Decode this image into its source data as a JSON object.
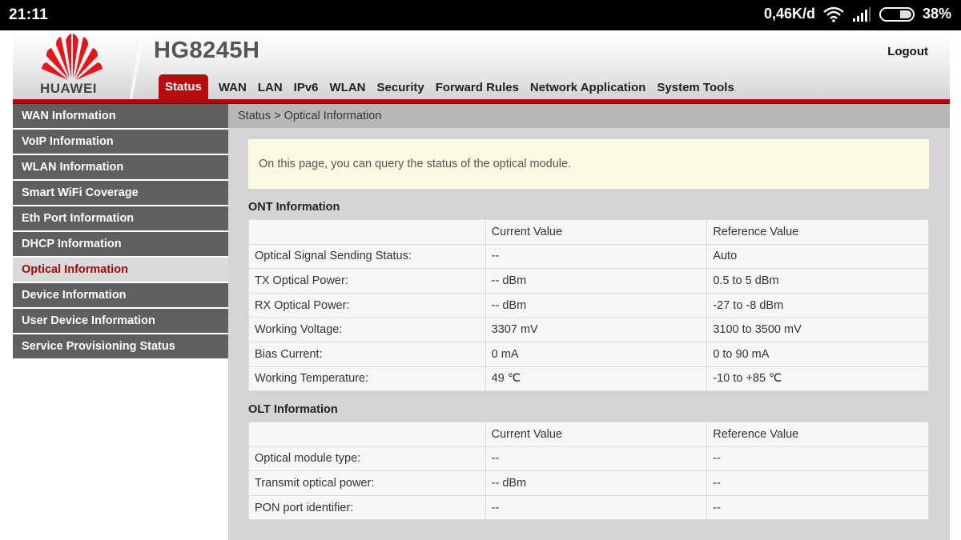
{
  "statusbar": {
    "time": "21:11",
    "network_speed": "0,46K/d",
    "battery": "38%",
    "icons": [
      "wifi-icon",
      "signal-icon",
      "battery-icon"
    ]
  },
  "header": {
    "brand": "HUAWEI",
    "model": "HG8245H",
    "logout_label": "Logout",
    "brand_color": "#b50d0d"
  },
  "topnav": {
    "tabs": [
      {
        "label": "Status",
        "active": true
      },
      {
        "label": "WAN"
      },
      {
        "label": "LAN"
      },
      {
        "label": "IPv6"
      },
      {
        "label": "WLAN"
      },
      {
        "label": "Security"
      },
      {
        "label": "Forward Rules"
      },
      {
        "label": "Network Application"
      },
      {
        "label": "System Tools"
      }
    ]
  },
  "sidebar": {
    "items": [
      {
        "label": "WAN Information"
      },
      {
        "label": "VoIP Information"
      },
      {
        "label": "WLAN Information"
      },
      {
        "label": "Smart WiFi Coverage"
      },
      {
        "label": "Eth Port Information"
      },
      {
        "label": "DHCP Information"
      },
      {
        "label": "Optical Information",
        "active": true
      },
      {
        "label": "Device Information"
      },
      {
        "label": "User Device Information"
      },
      {
        "label": "Service Provisioning Status"
      }
    ]
  },
  "main": {
    "breadcrumb": "Status > Optical Information",
    "notice": "On this page, you can query the status of the optical module.",
    "ont": {
      "title": "ONT Information",
      "headers": [
        "",
        "Current Value",
        "Reference Value"
      ],
      "rows": [
        [
          "Optical Signal Sending Status:",
          "--",
          "Auto"
        ],
        [
          "TX Optical Power:",
          "-- dBm",
          "0.5 to 5 dBm"
        ],
        [
          "RX Optical Power:",
          "-- dBm",
          "-27 to -8 dBm"
        ],
        [
          "Working Voltage:",
          "3307 mV",
          "3100 to 3500 mV"
        ],
        [
          "Bias Current:",
          "0 mA",
          "0 to 90 mA"
        ],
        [
          "Working Temperature:",
          "49 ℃",
          "-10 to +85 ℃"
        ]
      ]
    },
    "olt": {
      "title": "OLT Information",
      "headers": [
        "",
        "Current Value",
        "Reference Value"
      ],
      "rows": [
        [
          "Optical module type:",
          "--",
          "--"
        ],
        [
          "Transmit optical power:",
          "-- dBm",
          "--"
        ],
        [
          "PON port identifier:",
          "--",
          "--"
        ]
      ]
    }
  }
}
